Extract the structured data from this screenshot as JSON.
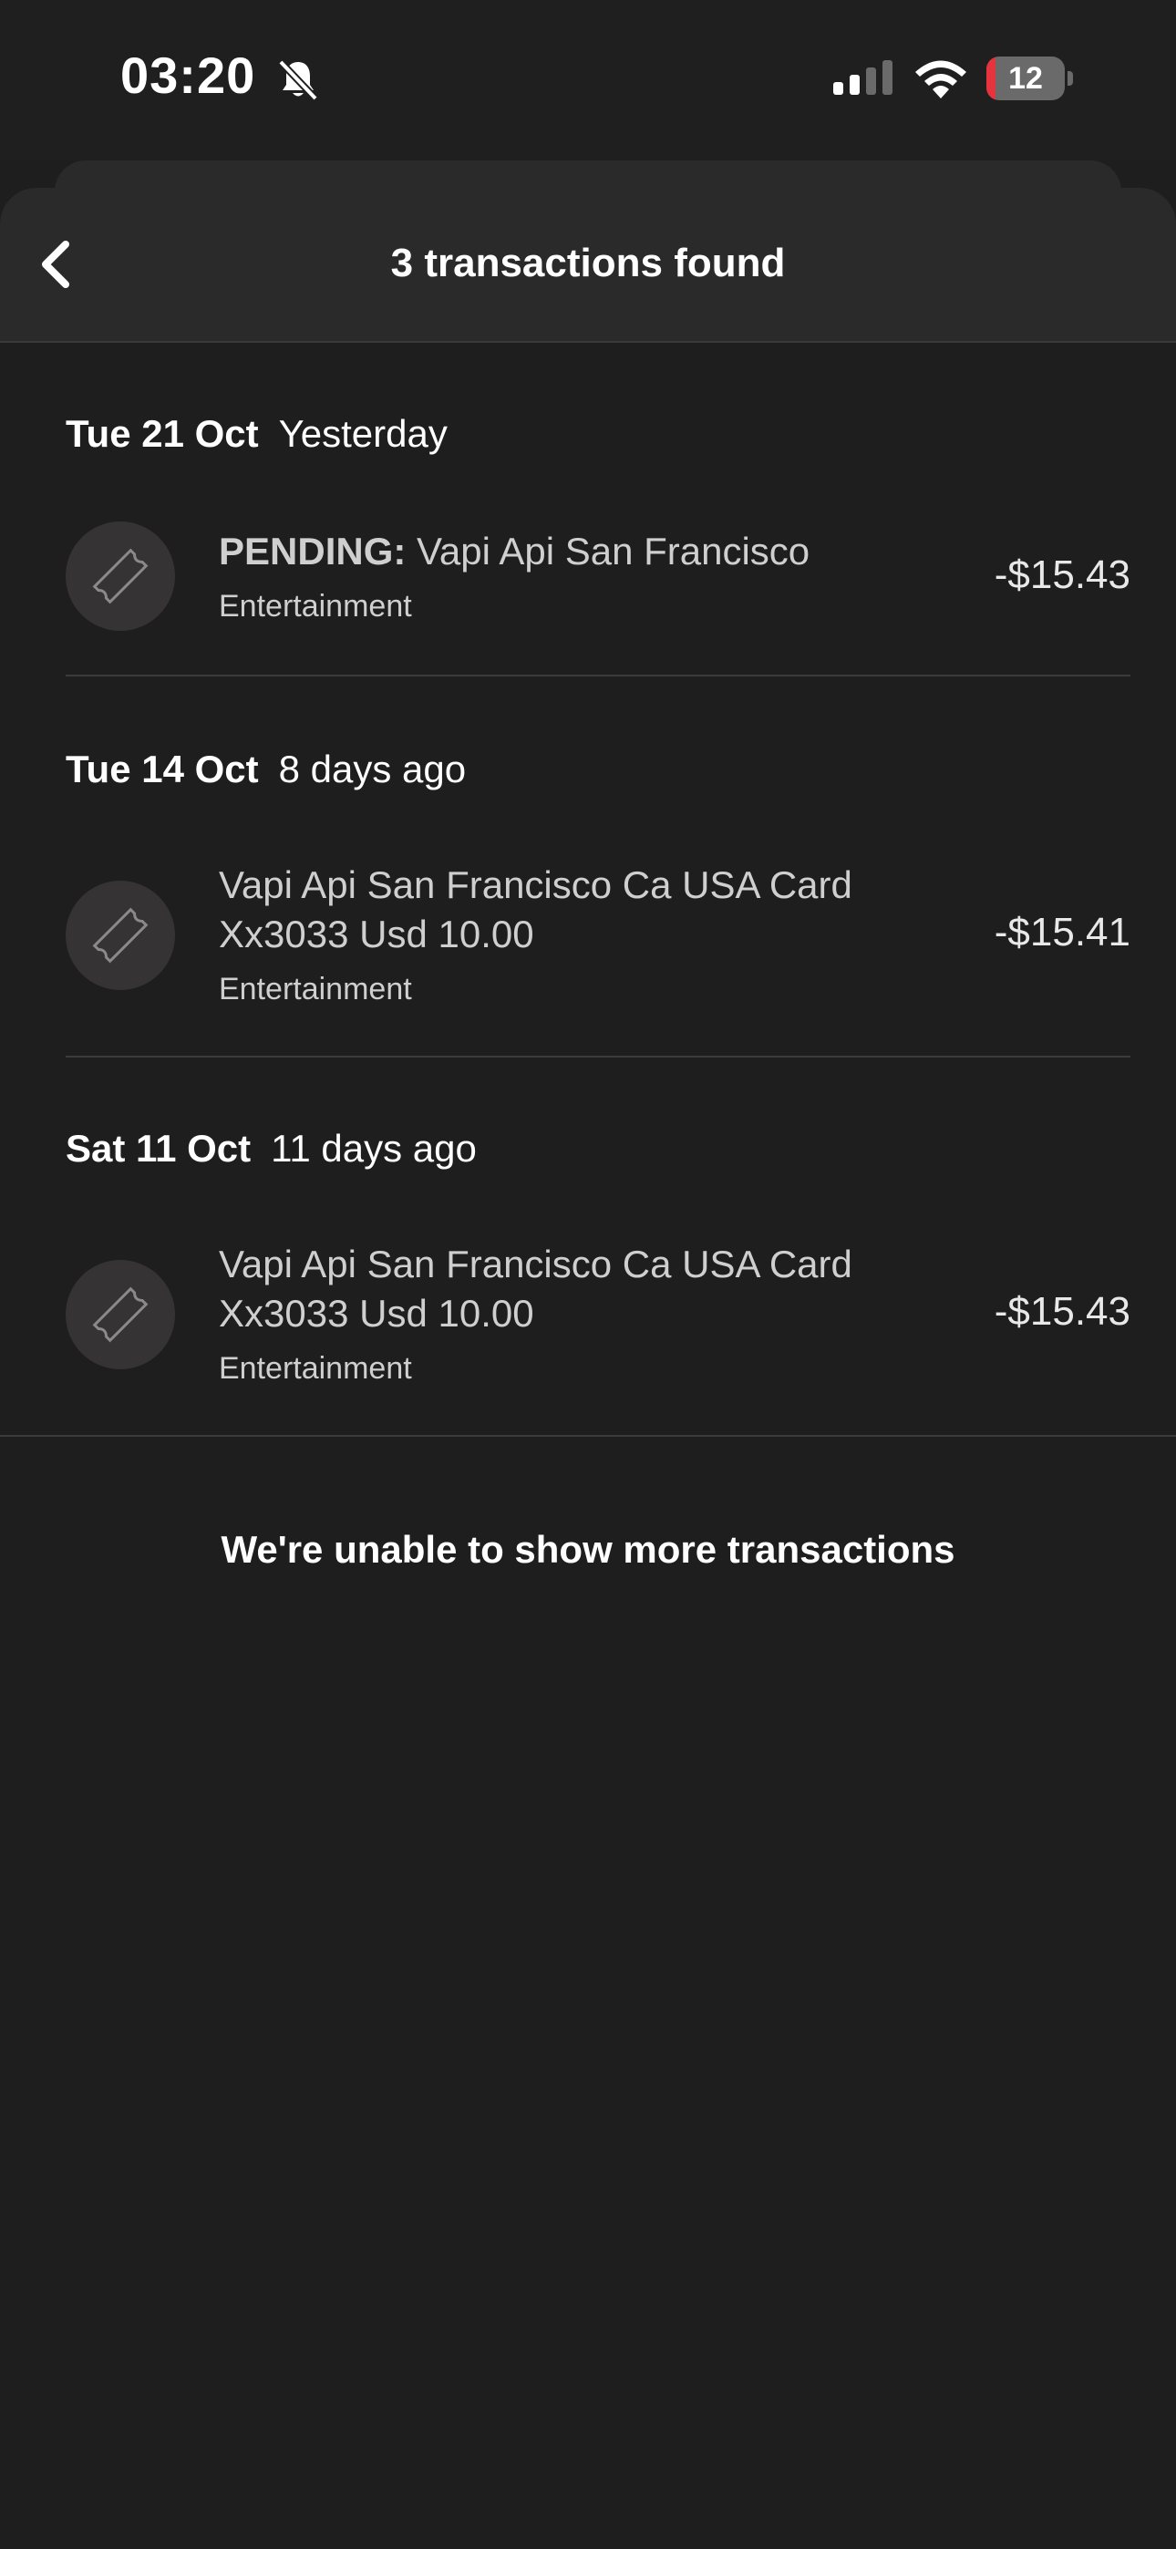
{
  "status_bar": {
    "time": "03:20",
    "battery_level": "12",
    "battery_fraction": 0.12,
    "icons": [
      "bell-off-icon",
      "signal-icon",
      "wifi-icon",
      "battery-icon"
    ]
  },
  "header": {
    "title": "3 transactions found",
    "back_icon": "chevron-left-icon"
  },
  "groups": [
    {
      "date": "Tue 21 Oct",
      "relative": "Yesterday",
      "transactions": [
        {
          "prefix": "PENDING:",
          "title": "Vapi Api San Francisco",
          "category": "Entertainment",
          "amount": "-$15.43",
          "icon": "ticket-icon"
        }
      ]
    },
    {
      "date": "Tue 14 Oct",
      "relative": "8 days ago",
      "transactions": [
        {
          "prefix": "",
          "title": "Vapi Api San Francisco Ca USA Card Xx3033 Usd 10.00",
          "category": "Entertainment",
          "amount": "-$15.41",
          "icon": "ticket-icon"
        }
      ]
    },
    {
      "date": "Sat 11 Oct",
      "relative": "11 days ago",
      "transactions": [
        {
          "prefix": "",
          "title": "Vapi Api San Francisco Ca USA Card Xx3033 Usd 10.00",
          "category": "Entertainment",
          "amount": "-$15.43",
          "icon": "ticket-icon"
        }
      ]
    }
  ],
  "footer": {
    "message": "We're unable to show more transactions"
  },
  "colors": {
    "background": "#1e1e1e",
    "header_bg": "#2a2a2a",
    "battery_low": "#e5343d",
    "icon_circle": "#353333"
  }
}
